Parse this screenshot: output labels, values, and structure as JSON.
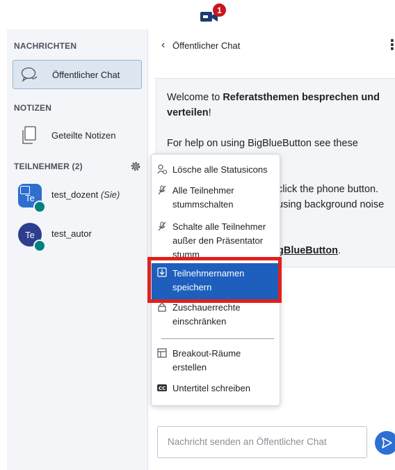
{
  "topbar": {
    "video_badge_count": "1"
  },
  "sidebar": {
    "messages_title": "NACHRICHTEN",
    "public_chat_label": "Öffentlicher Chat",
    "notes_title": "NOTIZEN",
    "shared_notes_label": "Geteilte Notizen",
    "participants_title": "TEILNEHMER (2)",
    "users": [
      {
        "initials": "Te",
        "name": "test_dozent",
        "suffix": "(Sie)",
        "presenter": true
      },
      {
        "initials": "Te",
        "name": "test_autor",
        "suffix": "",
        "presenter": false
      }
    ]
  },
  "chat": {
    "title": "Öffentlicher Chat",
    "welcome_line1_a": "Welcome to ",
    "welcome_line1_b": "Referatsthemen besprechen und",
    "welcome_line2": "verteilen",
    "welcome_line2_end": "!",
    "welcome_line3": "For help on using BigBlueButton see these",
    "welcome_line4": "click the phone button.",
    "welcome_line5": "using background noise",
    "welcome_line6_link": "gBlueButton",
    "welcome_line6_end": ".",
    "input_placeholder": "Nachricht senden an Öffentlicher Chat"
  },
  "menu": {
    "items": [
      {
        "label": "Lösche alle Statusicons",
        "icon": "clear-status-icon"
      },
      {
        "label": "Alle Teilnehmer stummschalten",
        "icon": "mute-icon"
      },
      {
        "label": "Schalte alle Teilnehmer außer den Präsentator stumm",
        "icon": "mute-icon"
      },
      {
        "label": "Teilnehmernamen speichern",
        "icon": "download-icon",
        "selected": true
      },
      {
        "label": "Zuschauerrechte einschränken",
        "icon": "lock-icon"
      },
      {
        "label": "Breakout-Räume erstellen",
        "icon": "rooms-icon"
      },
      {
        "label": "Untertitel schreiben",
        "icon": "closed-caption-icon"
      }
    ]
  },
  "colors": {
    "accent": "#1e5fbd",
    "highlight": "#e2201b",
    "badge": "#c8161d",
    "audio": "#008081"
  }
}
